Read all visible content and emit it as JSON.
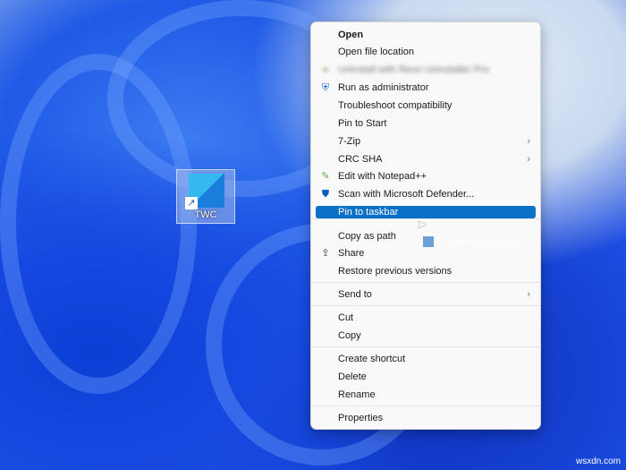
{
  "desktop": {
    "icon_label": "TWC"
  },
  "menu": {
    "items": [
      {
        "label": "Open",
        "bold": true
      },
      {
        "label": "Open file location"
      },
      {
        "label": "Uninstall with Revo Uninstaller Pro",
        "blurred": true,
        "icon": "revo-icon"
      },
      {
        "label": "Run as administrator",
        "icon": "uac-shield-icon"
      },
      {
        "label": "Troubleshoot compatibility"
      },
      {
        "label": "Pin to Start"
      },
      {
        "label": "7-Zip",
        "submenu": true
      },
      {
        "label": "CRC SHA",
        "submenu": true
      },
      {
        "label": "Edit with Notepad++",
        "icon": "notepadpp-icon"
      },
      {
        "label": "Scan with Microsoft Defender...",
        "icon": "defender-icon"
      },
      {
        "label": "Pin to taskbar",
        "highlighted": true
      },
      {
        "label": "Copy as path"
      },
      {
        "label": "Share",
        "icon": "share-icon"
      },
      {
        "label": "Restore previous versions"
      },
      {
        "label": "Send to",
        "submenu": true
      },
      {
        "label": "Cut"
      },
      {
        "label": "Copy"
      },
      {
        "label": "Create shortcut"
      },
      {
        "label": "Delete"
      },
      {
        "label": "Rename"
      },
      {
        "label": "Properties"
      }
    ]
  },
  "watermark": "TheWindowsClub",
  "site_mark": "wsxdn.com",
  "colors": {
    "highlight": "#0a70c8",
    "menu_bg": "#f9f9f9"
  }
}
